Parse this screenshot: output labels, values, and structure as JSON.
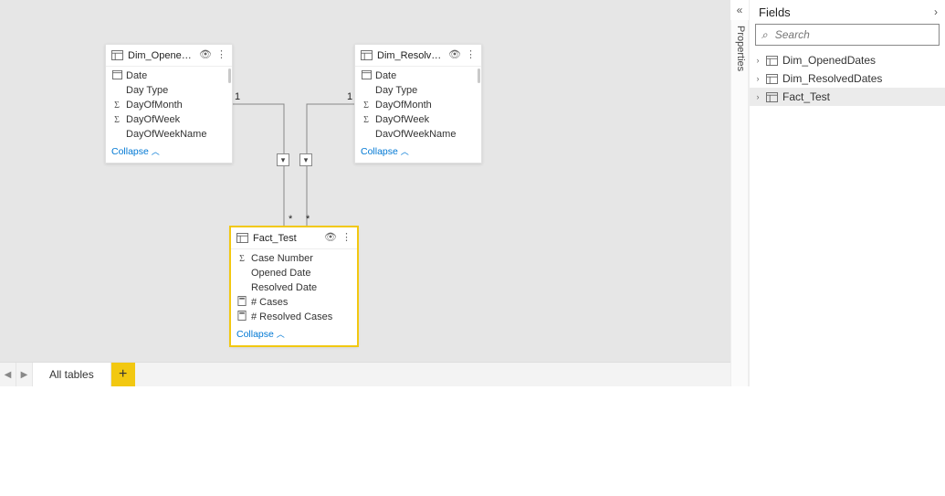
{
  "fields_pane": {
    "title": "Fields",
    "search_placeholder": "Search",
    "tables": [
      {
        "name": "Dim_OpenedDates",
        "selected": false
      },
      {
        "name": "Dim_ResolvedDates",
        "selected": false
      },
      {
        "name": "Fact_Test",
        "selected": true
      }
    ]
  },
  "properties_pane": {
    "label": "Properties"
  },
  "tabbar": {
    "tabs": [
      {
        "label": "All tables"
      }
    ]
  },
  "collapse_label": "Collapse",
  "tables": {
    "dim_opened": {
      "title": "Dim_OpenedDates",
      "fields": [
        {
          "icon": "date",
          "name": "Date"
        },
        {
          "icon": "",
          "name": "Day Type"
        },
        {
          "icon": "sigma",
          "name": "DayOfMonth"
        },
        {
          "icon": "sigma",
          "name": "DayOfWeek"
        },
        {
          "icon": "",
          "name": "DayOfWeekName"
        }
      ]
    },
    "dim_resolved": {
      "title": "Dim_ResolvedDates",
      "fields": [
        {
          "icon": "date",
          "name": "Date"
        },
        {
          "icon": "",
          "name": "Day Type"
        },
        {
          "icon": "sigma",
          "name": "DayOfMonth"
        },
        {
          "icon": "sigma",
          "name": "DayOfWeek"
        },
        {
          "icon": "",
          "name": "DavOfWeekName"
        }
      ]
    },
    "fact": {
      "title": "Fact_Test",
      "fields": [
        {
          "icon": "sigma",
          "name": "Case Number"
        },
        {
          "icon": "",
          "name": "Opened Date"
        },
        {
          "icon": "",
          "name": "Resolved Date"
        },
        {
          "icon": "calc",
          "name": "# Cases"
        },
        {
          "icon": "calc",
          "name": "# Resolved Cases"
        }
      ]
    }
  },
  "relationships": [
    {
      "from": "dim_opened",
      "to": "fact",
      "from_card": "1",
      "to_card": "*"
    },
    {
      "from": "dim_resolved",
      "to": "fact",
      "from_card": "1",
      "to_card": "*"
    }
  ]
}
